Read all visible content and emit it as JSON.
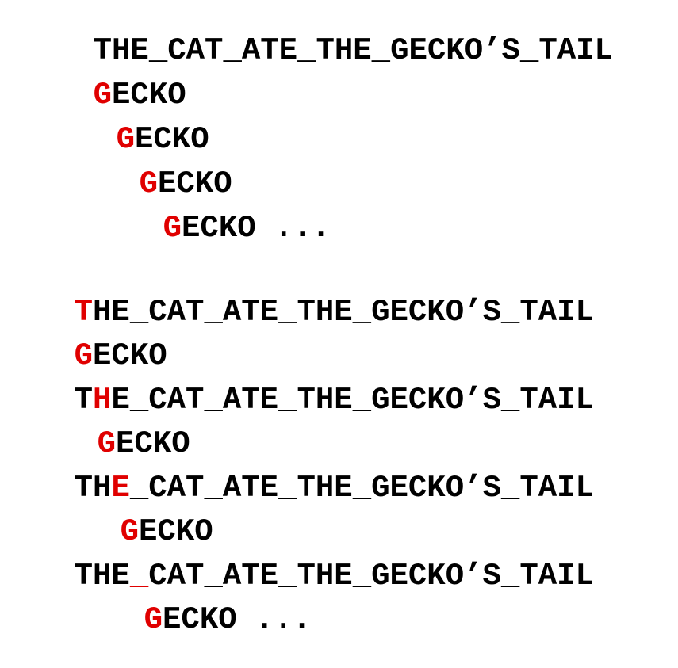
{
  "colors": {
    "text": "#000000",
    "highlight": "#e00000"
  },
  "naive_example": {
    "text_line": {
      "before": "",
      "highlight": "",
      "after": "THE_CAT_ATE_THE_GECKO’S_TAIL"
    },
    "pattern_rows": [
      {
        "highlight": "G",
        "rest": "ECKO"
      },
      {
        "highlight": "G",
        "rest": "ECKO"
      },
      {
        "highlight": "G",
        "rest": "ECKO"
      },
      {
        "highlight": "G",
        "rest": "ECKO ..."
      }
    ]
  },
  "comparison_example": {
    "pairs": [
      {
        "text": {
          "before": "",
          "highlight": "T",
          "after": "HE_CAT_ATE_THE_GECKO’S_TAIL"
        },
        "pattern": {
          "highlight": "G",
          "rest": "ECKO"
        }
      },
      {
        "text": {
          "before": "T",
          "highlight": "H",
          "after": "E_CAT_ATE_THE_GECKO’S_TAIL"
        },
        "pattern": {
          "highlight": "G",
          "rest": "ECKO"
        }
      },
      {
        "text": {
          "before": "TH",
          "highlight": "E",
          "after": "_CAT_ATE_THE_GECKO’S_TAIL"
        },
        "pattern": {
          "highlight": "G",
          "rest": "ECKO"
        }
      },
      {
        "text": {
          "before": "THE",
          "highlight": "_",
          "after": "CAT_ATE_THE_GECKO’S_TAIL"
        },
        "pattern": {
          "highlight": "G",
          "rest": "ECKO ..."
        }
      }
    ]
  }
}
